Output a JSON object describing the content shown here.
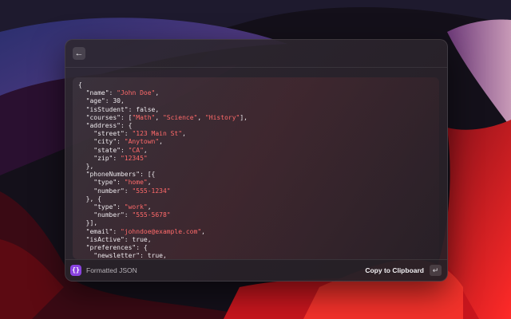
{
  "window": {
    "back_icon": "arrow-left-icon",
    "footer": {
      "icon": "curly-braces-icon",
      "icon_glyph": "{}",
      "label": "Formatted JSON",
      "action_label": "Copy to Clipboard",
      "enter_key_icon": "return-key-icon",
      "accent_color": "#8a43e0"
    }
  },
  "code_lines": [
    [
      {
        "t": "{"
      }
    ],
    [
      {
        "t": "  \"name\": "
      },
      {
        "t": "\"John Doe\"",
        "s": 1
      },
      {
        "t": ","
      }
    ],
    [
      {
        "t": "  \"age\": 30,"
      }
    ],
    [
      {
        "t": "  \"isStudent\": false,"
      }
    ],
    [
      {
        "t": "  \"courses\": ["
      },
      {
        "t": "\"Math\"",
        "s": 1
      },
      {
        "t": ", "
      },
      {
        "t": "\"Science\"",
        "s": 1
      },
      {
        "t": ", "
      },
      {
        "t": "\"History\"",
        "s": 1
      },
      {
        "t": "],"
      }
    ],
    [
      {
        "t": "  \"address\": {"
      }
    ],
    [
      {
        "t": "    \"street\": "
      },
      {
        "t": "\"123 Main St\"",
        "s": 1
      },
      {
        "t": ","
      }
    ],
    [
      {
        "t": "    \"city\": "
      },
      {
        "t": "\"Anytown\"",
        "s": 1
      },
      {
        "t": ","
      }
    ],
    [
      {
        "t": "    \"state\": "
      },
      {
        "t": "\"CA\"",
        "s": 1
      },
      {
        "t": ","
      }
    ],
    [
      {
        "t": "    \"zip\": "
      },
      {
        "t": "\"12345\"",
        "s": 1
      }
    ],
    [
      {
        "t": "  },"
      }
    ],
    [
      {
        "t": "  \"phoneNumbers\": [{"
      }
    ],
    [
      {
        "t": "    \"type\": "
      },
      {
        "t": "\"home\"",
        "s": 1
      },
      {
        "t": ","
      }
    ],
    [
      {
        "t": "    \"number\": "
      },
      {
        "t": "\"555-1234\"",
        "s": 1
      }
    ],
    [
      {
        "t": "  }, {"
      }
    ],
    [
      {
        "t": "    \"type\": "
      },
      {
        "t": "\"work\"",
        "s": 1
      },
      {
        "t": ","
      }
    ],
    [
      {
        "t": "    \"number\": "
      },
      {
        "t": "\"555-5678\"",
        "s": 1
      }
    ],
    [
      {
        "t": "  }],"
      }
    ],
    [
      {
        "t": "  \"email\": "
      },
      {
        "t": "\"johndoe@example.com\"",
        "s": 1
      },
      {
        "t": ","
      }
    ],
    [
      {
        "t": "  \"isActive\": true,"
      }
    ],
    [
      {
        "t": "  \"preferences\": {"
      }
    ],
    [
      {
        "t": "    \"newsletter\": true,"
      }
    ]
  ],
  "colors": {
    "string": "#ff6a6a",
    "text": "#ece8ec"
  }
}
